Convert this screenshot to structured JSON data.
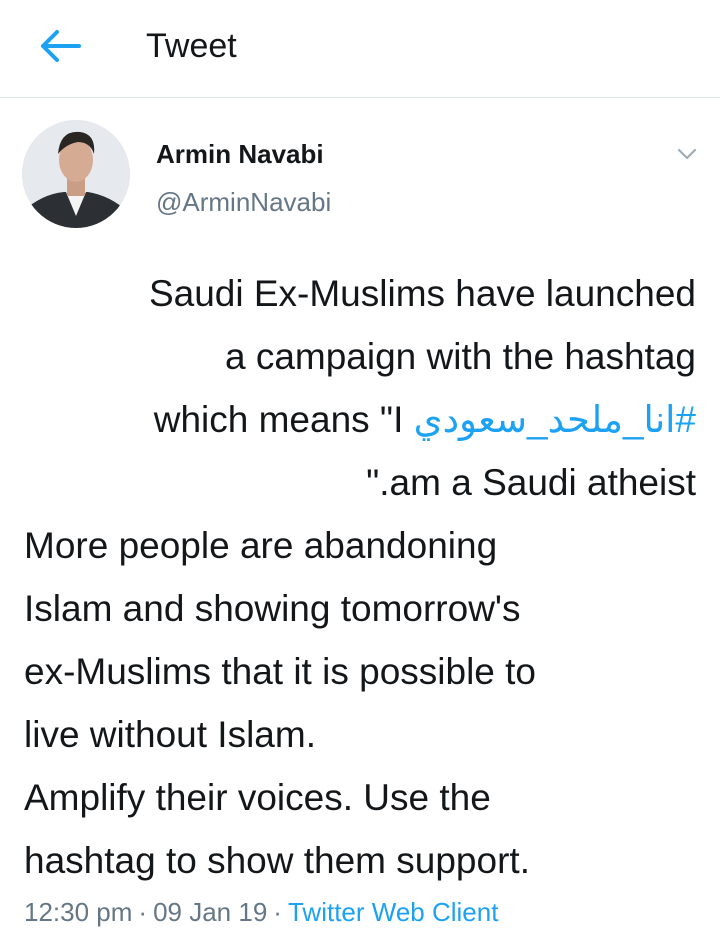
{
  "header": {
    "title": "Tweet",
    "back_icon": "arrow-left-icon",
    "accent_color": "#1da1f2"
  },
  "author": {
    "display_name": "Armin Navabi",
    "handle": "@ArminNavabi",
    "avatar_icon": "avatar-photo",
    "menu_icon": "chevron-down-icon"
  },
  "tweet": {
    "line1": "Saudi Ex-Muslims have launched",
    "line2": "a campaign with the hashtag",
    "line3_prefix": "which means \"I ",
    "hashtag": "#انا_ملحد_سعودي",
    "line4": "\".am a Saudi atheist",
    "line5": "More people are abandoning",
    "line6": "Islam and showing tomorrow's",
    "line7": "ex-Muslims that it is possible to",
    "line8": "live without Islam.",
    "line9": "Amplify their voices. Use the",
    "line10": "hashtag to show them support."
  },
  "meta": {
    "time": "12:30 pm",
    "date": "09 Jan 19",
    "separator": "·",
    "client": "Twitter Web Client"
  }
}
